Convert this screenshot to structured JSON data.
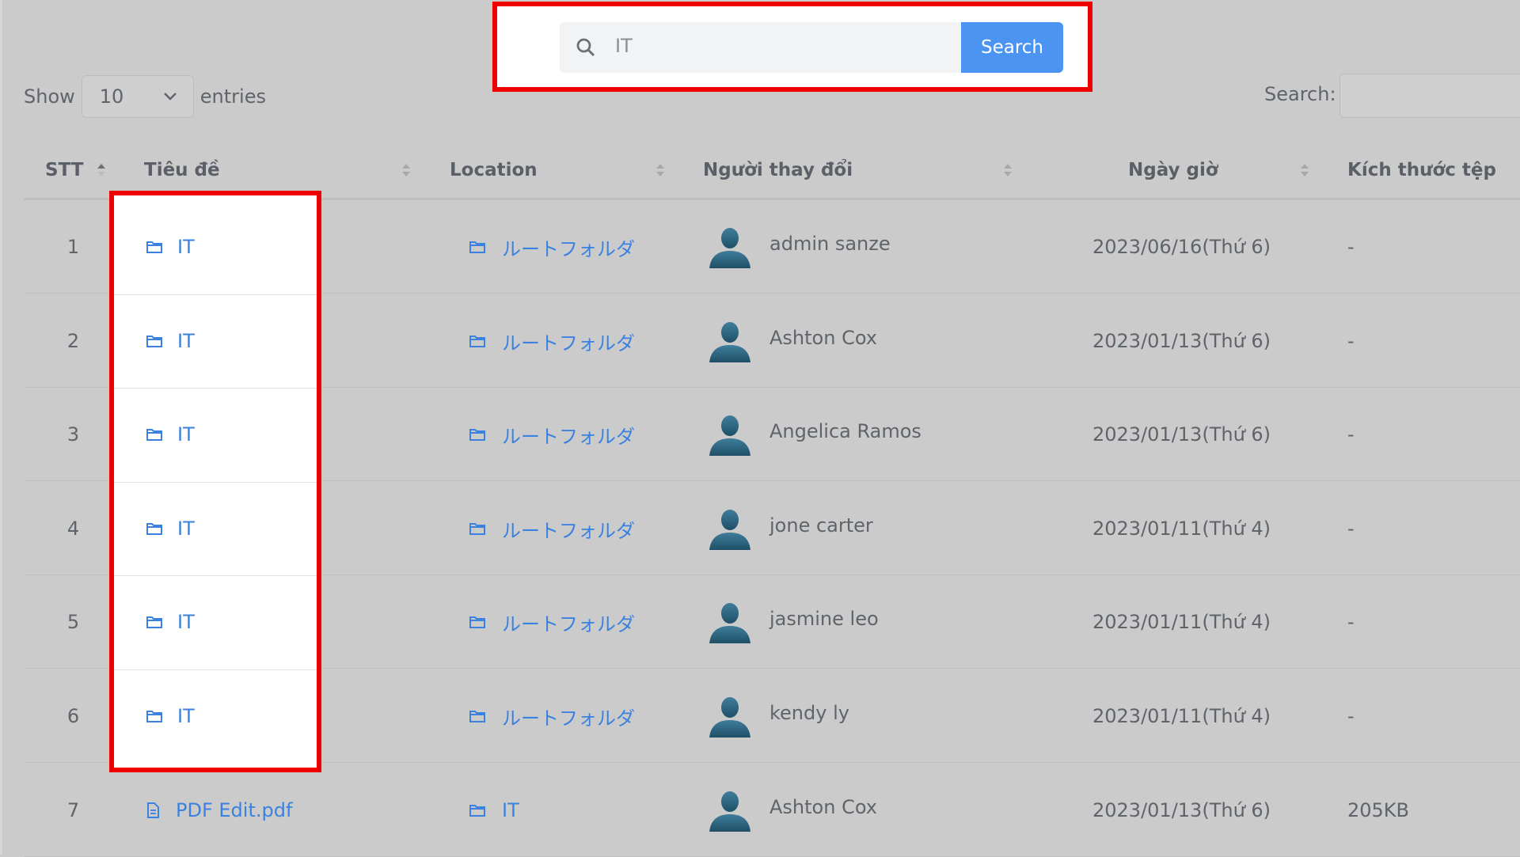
{
  "top_search": {
    "value": "IT",
    "button_label": "Search",
    "icon": "search-icon"
  },
  "controls": {
    "show_label": "Show",
    "entries_value": "10",
    "entries_label": "entries",
    "search_label": "Search:"
  },
  "table": {
    "columns": [
      {
        "label": "STT"
      },
      {
        "label": "Tiêu đề"
      },
      {
        "label": "Location"
      },
      {
        "label": "Người thay đổi"
      },
      {
        "label": "Ngày giờ"
      },
      {
        "label": "Kích thước tệp"
      }
    ],
    "rows": [
      {
        "stt": "1",
        "title": "IT",
        "title_icon": "folder-icon",
        "location": "ルートフォルダ",
        "user": "admin sanze",
        "date": "2023/06/16(Thứ 6)",
        "size": "-"
      },
      {
        "stt": "2",
        "title": "IT",
        "title_icon": "folder-icon",
        "location": "ルートフォルダ",
        "user": "Ashton Cox",
        "date": "2023/01/13(Thứ 6)",
        "size": "-"
      },
      {
        "stt": "3",
        "title": "IT",
        "title_icon": "folder-icon",
        "location": "ルートフォルダ",
        "user": "Angelica Ramos",
        "date": "2023/01/13(Thứ 6)",
        "size": "-"
      },
      {
        "stt": "4",
        "title": "IT",
        "title_icon": "folder-icon",
        "location": "ルートフォルダ",
        "user": "jone carter",
        "date": "2023/01/11(Thứ 4)",
        "size": "-"
      },
      {
        "stt": "5",
        "title": "IT",
        "title_icon": "folder-icon",
        "location": "ルートフォルダ",
        "user": "jasmine leo",
        "date": "2023/01/11(Thứ 4)",
        "size": "-"
      },
      {
        "stt": "6",
        "title": "IT",
        "title_icon": "folder-icon",
        "location": "ルートフォルダ",
        "user": "kendy ly",
        "date": "2023/01/11(Thứ 4)",
        "size": "-"
      },
      {
        "stt": "7",
        "title": "PDF Edit.pdf",
        "title_icon": "file-icon",
        "location": "IT",
        "user": "Ashton Cox",
        "date": "2023/01/13(Thứ 6)",
        "size": "205KB"
      }
    ]
  },
  "colors": {
    "highlight": "#ee0000",
    "accent": "#4b94f2",
    "link": "#3b82e0",
    "overlay": "#cbcbcb"
  }
}
